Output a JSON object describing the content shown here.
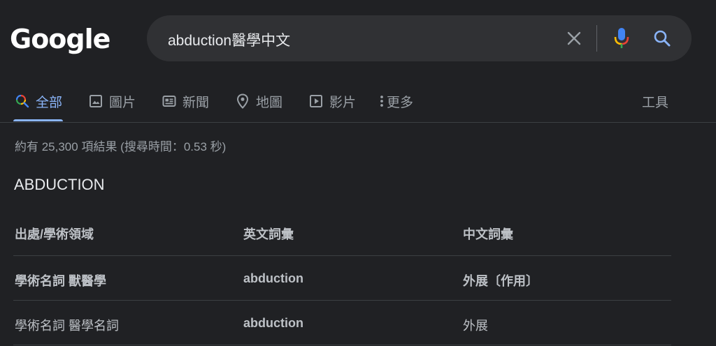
{
  "logo": {
    "text": "Google"
  },
  "search": {
    "query": "abduction醫學中文",
    "icons": [
      "close-icon",
      "microphone-icon",
      "search-icon"
    ]
  },
  "tabs": [
    {
      "label": "全部",
      "icon": "search-icon",
      "active": true
    },
    {
      "label": "圖片",
      "icon": "image-icon"
    },
    {
      "label": "新聞",
      "icon": "news-icon"
    },
    {
      "label": "地圖",
      "icon": "map-pin-icon"
    },
    {
      "label": "影片",
      "icon": "play-icon"
    },
    {
      "label": "更多",
      "icon": "more-vert-icon"
    }
  ],
  "tools_label": "工具",
  "stats": "約有 25,300 項結果 (搜尋時間：0.53 秒)",
  "result": {
    "heading": "ABDUCTION",
    "columns": [
      "出處/學術領域",
      "英文詞彙",
      "中文詞彙"
    ],
    "rows": [
      {
        "source": "學術名詞 獸醫學",
        "english": "abduction",
        "chinese": "外展〔作用〕",
        "bold": true
      },
      {
        "source": "學術名詞 醫學名詞",
        "english": "abduction",
        "chinese": "外展",
        "bold": false
      }
    ]
  },
  "colors": {
    "background": "#202124",
    "accent": "#8ab4f8",
    "searchbox": "#303134",
    "muted_text": "#9aa0a6"
  }
}
